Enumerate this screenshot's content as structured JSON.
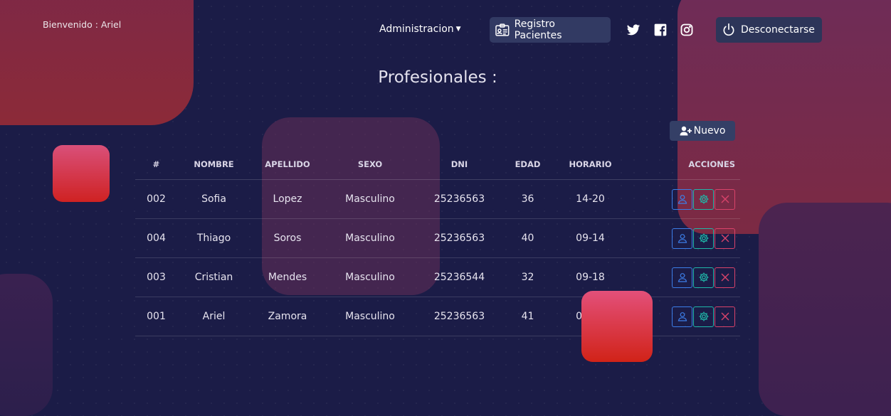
{
  "header": {
    "welcome": "Bienvenido : Ariel",
    "admin_menu": "Administracion",
    "registro_button": "Registro Pacientes",
    "logout_button": "Desconectarse",
    "social": [
      "twitter-icon",
      "facebook-icon",
      "instagram-icon"
    ]
  },
  "page": {
    "title": "Profesionales :",
    "new_button": "Nuevo"
  },
  "table": {
    "columns": [
      "#",
      "NOMBRE",
      "APELLIDO",
      "SEXO",
      "DNI",
      "EDAD",
      "HORARIO",
      "ACCIONES"
    ],
    "rows": [
      [
        "002",
        "Sofia",
        "Lopez",
        "Masculino",
        "25236563",
        "36",
        "14-20"
      ],
      [
        "004",
        "Thiago",
        "Soros",
        "Masculino",
        "25236563",
        "40",
        "09-14"
      ],
      [
        "003",
        "Cristian",
        "Mendes",
        "Masculino",
        "25236544",
        "32",
        "09-18"
      ],
      [
        "001",
        "Ariel",
        "Zamora",
        "Masculino",
        "25236563",
        "41",
        "09-14"
      ]
    ],
    "actions": [
      "user-icon",
      "gear-icon",
      "close-icon"
    ]
  },
  "colors": {
    "background": "#1b1c47",
    "view": "#3c7ee8",
    "edit": "#1fb7a8",
    "delete": "#d9436a"
  }
}
